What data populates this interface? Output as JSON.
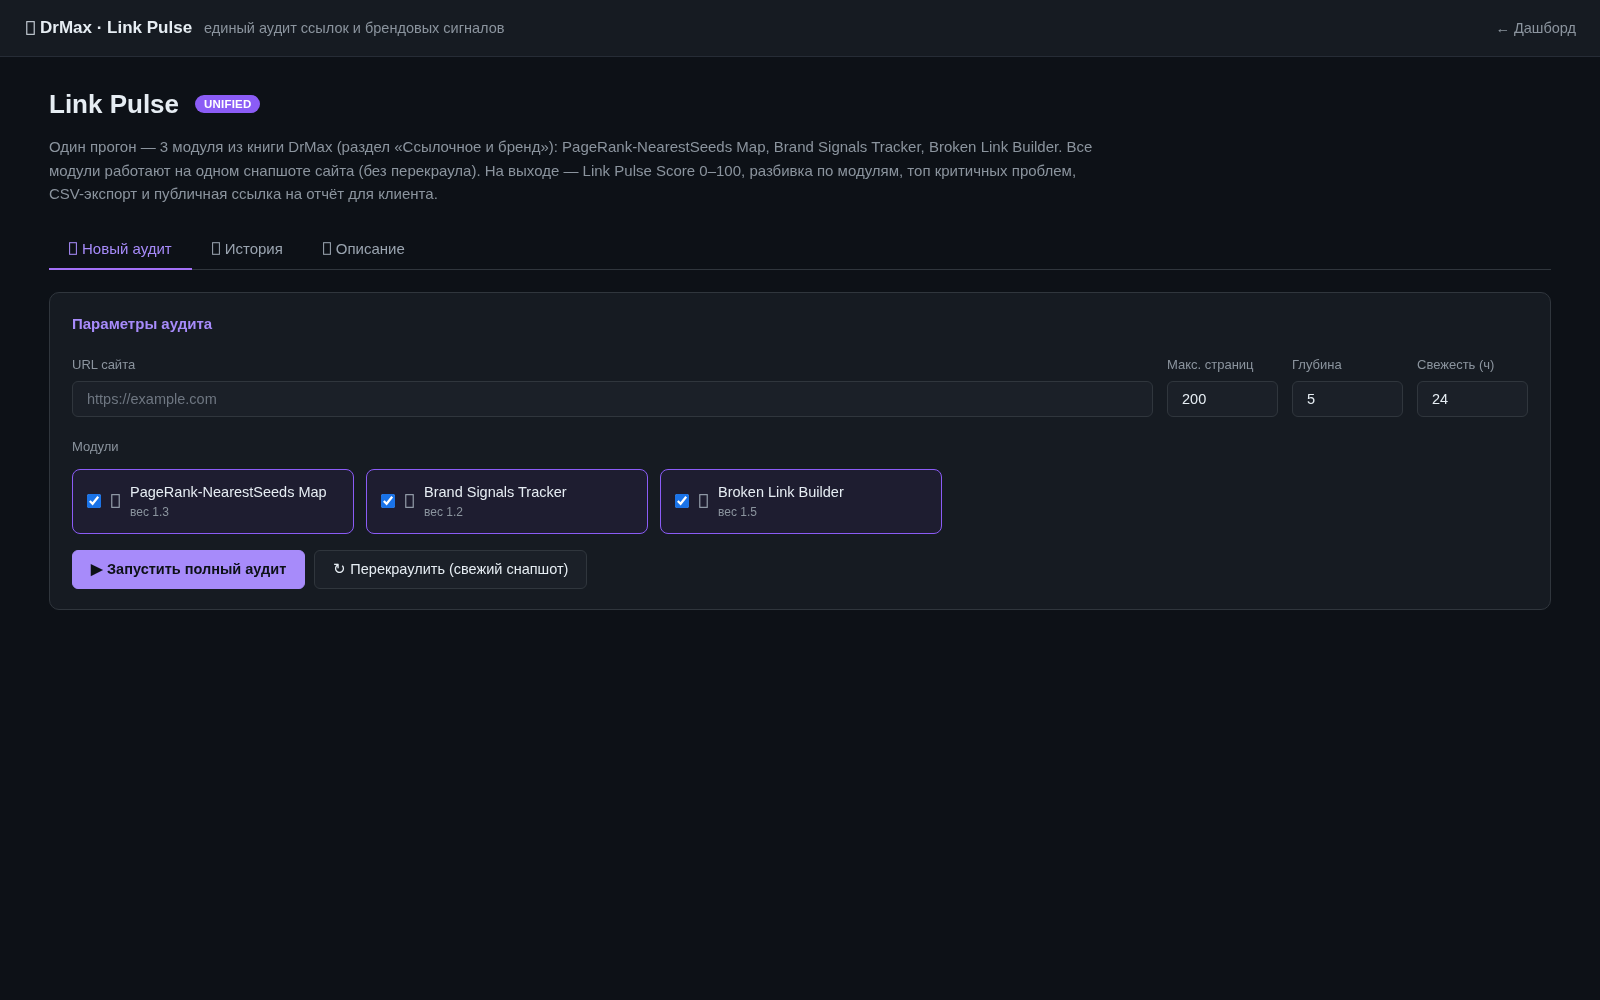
{
  "header": {
    "brand": "DrMax · Link Pulse",
    "subtitle": "единый аудит ссылок и брендовых сигналов",
    "back_link": "← Дашборд"
  },
  "page": {
    "title": "Link Pulse",
    "badge": "UNIFIED",
    "description": "Один прогон — 3 модуля из книги DrMax (раздел «Ссылочное и бренд»): PageRank-NearestSeeds Map, Brand Signals Tracker, Broken Link Builder. Все модули работают на одном снапшоте сайта (без перекраула). На выходе — Link Pulse Score 0–100, разбивка по модулям, топ критичных проблем, CSV-экспорт и публичная ссылка на отчёт для клиента."
  },
  "tabs": [
    {
      "label": "Новый аудит",
      "selected": true
    },
    {
      "label": "История",
      "selected": false
    },
    {
      "label": "Описание",
      "selected": false
    }
  ],
  "form": {
    "title": "Параметры аудита",
    "fields": [
      {
        "label": "URL сайта",
        "placeholder": "https://example.com"
      },
      {
        "label": "Макс. страниц",
        "value": "200"
      },
      {
        "label": "Глубина",
        "value": "5"
      },
      {
        "label": "Свежесть (ч)",
        "value": "24"
      }
    ],
    "modules_label": "Модули",
    "modules": [
      {
        "name": "PageRank-NearestSeeds Map",
        "weight": "вес 1.3",
        "checked": true
      },
      {
        "name": "Brand Signals Tracker",
        "weight": "вес 1.2",
        "checked": true
      },
      {
        "name": "Broken Link Builder",
        "weight": "вес 1.5",
        "checked": true
      }
    ],
    "buttons": [
      {
        "label": "▶ Запустить полный аудит",
        "kind": "primary"
      },
      {
        "label": "↻ Перекраулить (свежий снапшот)",
        "kind": "secondary"
      }
    ]
  }
}
